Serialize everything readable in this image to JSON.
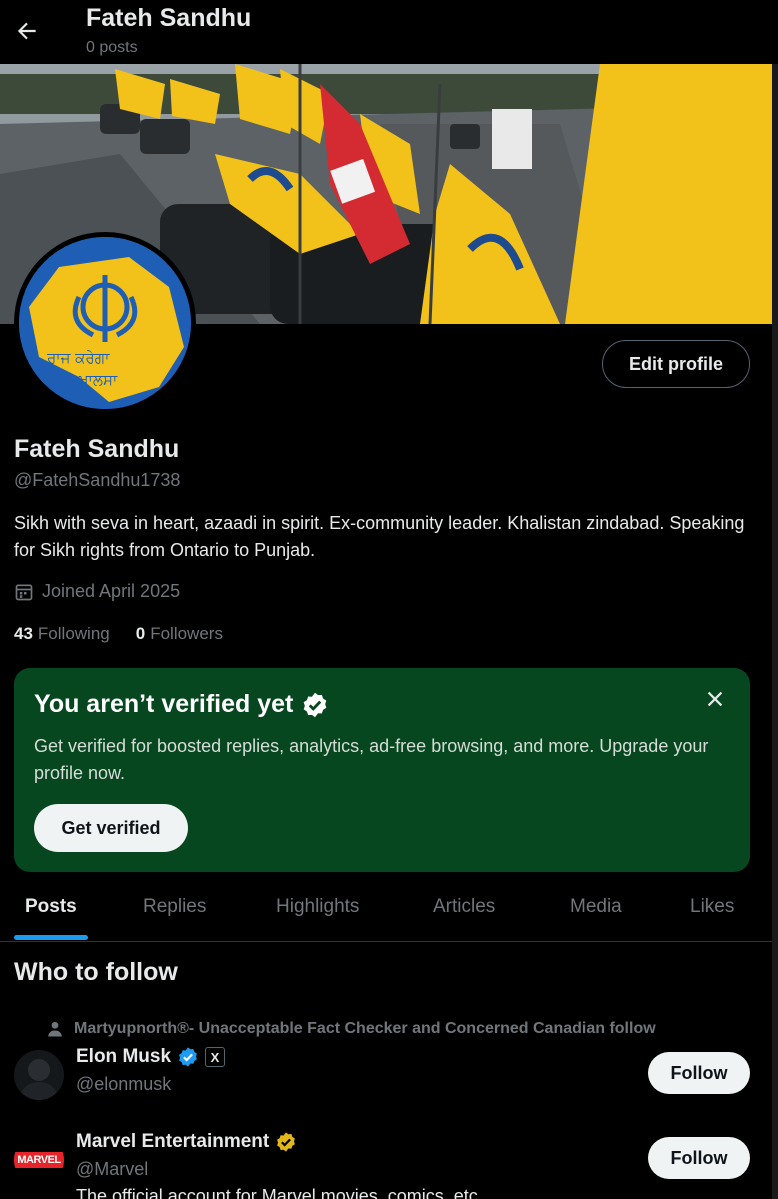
{
  "header": {
    "name": "Fateh Sandhu",
    "posts": "0 posts"
  },
  "profile": {
    "display_name": "Fateh Sandhu",
    "handle": "@FatehSandhu1738",
    "bio": "Sikh with seva in heart, azaadi in spirit. Ex-community leader. Khalistan zindabad. Speaking for Sikh rights from Ontario to Punjab.",
    "joined": "Joined April 2025",
    "following_count": "43",
    "following_label": "Following",
    "followers_count": "0",
    "followers_label": "Followers",
    "edit_label": "Edit profile",
    "avatar_text_top": "ਰਾਜ ਕਰੇਗਾ",
    "avatar_text_bottom": "ਖ਼ਾਲਸਾ"
  },
  "verify_card": {
    "title": "You aren’t verified yet",
    "text": "Get verified for boosted replies, analytics, ad-free browsing, and more. Upgrade your profile now.",
    "button": "Get verified"
  },
  "tabs": [
    "Posts",
    "Replies",
    "Highlights",
    "Articles",
    "Media",
    "Likes"
  ],
  "active_tab": "Posts",
  "who_to_follow": {
    "title": "Who to follow",
    "social_context": "Martyupnorth®- Unacceptable Fact Checker and Concerned Canadian follow",
    "accounts": [
      {
        "name": "Elon Musk",
        "handle": "@elonmusk",
        "badge": "blue-verified",
        "button": "Follow",
        "affiliate": "X"
      },
      {
        "name": "Marvel Entertainment",
        "handle": "@Marvel",
        "badge": "gold-verified",
        "button": "Follow",
        "logo_text": "MARVEL"
      }
    ],
    "truncated_bio": "The official account for Marvel movies, comics, etc..."
  },
  "colors": {
    "accent": "#1d9bf0",
    "verify_bg": "#07471f",
    "gold": "#e2b719",
    "flag_yellow": "#f2c21a"
  }
}
